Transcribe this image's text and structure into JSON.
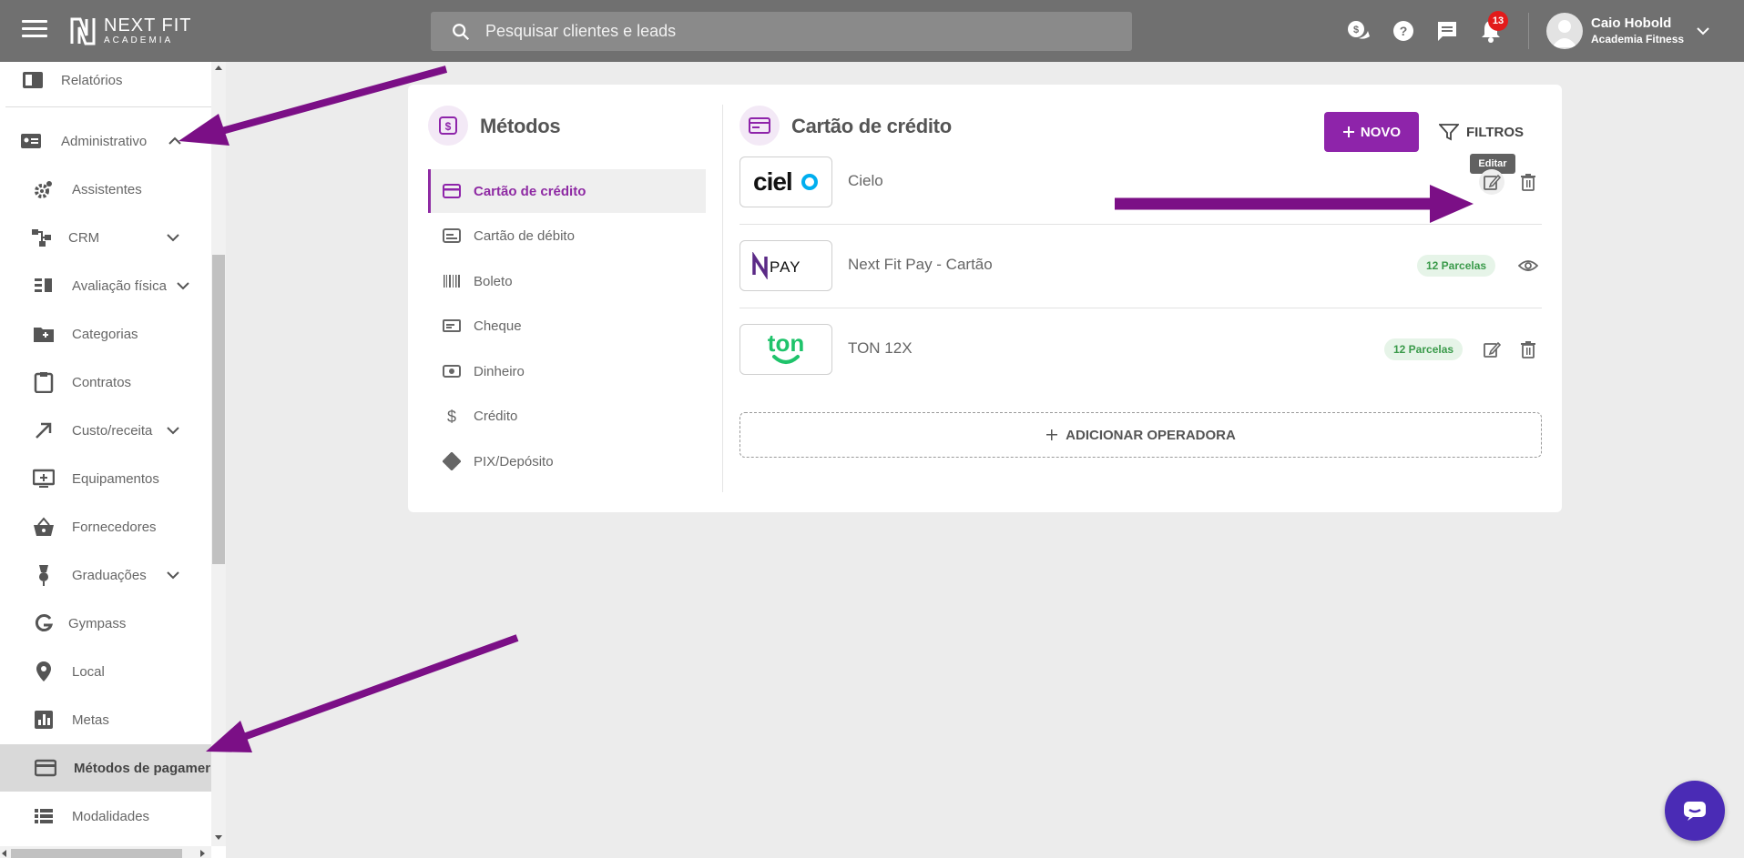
{
  "brand": {
    "name": "NEXT FIT",
    "sub": "ACADEMIA"
  },
  "search": {
    "placeholder": "Pesquisar clientes e leads"
  },
  "notifications": {
    "count": "13"
  },
  "user": {
    "name": "Caio Hobold",
    "org": "Academia Fitness"
  },
  "sidebar": {
    "items": [
      {
        "label": "Relatórios"
      },
      {
        "label": "Administrativo"
      },
      {
        "label": "Assistentes"
      },
      {
        "label": "CRM"
      },
      {
        "label": "Avaliação física"
      },
      {
        "label": "Categorias"
      },
      {
        "label": "Contratos"
      },
      {
        "label": "Custo/receita"
      },
      {
        "label": "Equipamentos"
      },
      {
        "label": "Fornecedores"
      },
      {
        "label": "Graduações"
      },
      {
        "label": "Gympass"
      },
      {
        "label": "Local"
      },
      {
        "label": "Metas"
      },
      {
        "label": "Métodos de pagamen"
      },
      {
        "label": "Modalidades"
      }
    ]
  },
  "methods": {
    "title": "Métodos",
    "items": [
      {
        "label": "Cartão de crédito"
      },
      {
        "label": "Cartão de débito"
      },
      {
        "label": "Boleto"
      },
      {
        "label": "Cheque"
      },
      {
        "label": "Dinheiro"
      },
      {
        "label": "Crédito"
      },
      {
        "label": "PIX/Depósito"
      }
    ]
  },
  "detail": {
    "title": "Cartão de crédito",
    "new_label": "NOVO",
    "filters_label": "FILTROS",
    "tooltip": "Editar",
    "operators": [
      {
        "logo": "cielo",
        "name": "Cielo",
        "badge": ""
      },
      {
        "logo": "PAY",
        "name": "Next Fit Pay - Cartão",
        "badge": "12 Parcelas"
      },
      {
        "logo": "ton",
        "name": "TON 12X",
        "badge": "12 Parcelas"
      }
    ],
    "add_label": "ADICIONAR OPERADORA"
  },
  "colors": {
    "accent": "#8e24aa",
    "topbar": "#707070",
    "arrow": "#7b0f86",
    "badge_bg": "#e6f4e8",
    "badge_text": "#3a9a4a"
  }
}
